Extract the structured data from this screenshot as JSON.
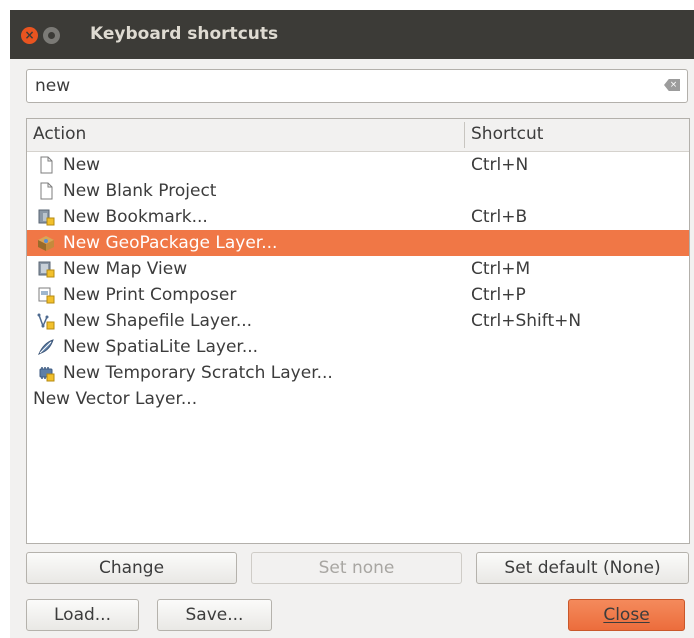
{
  "window": {
    "title": "Keyboard shortcuts",
    "close_glyph": "×"
  },
  "search": {
    "value": "new",
    "clear_glyph": "×"
  },
  "table": {
    "columns": [
      "Action",
      "Shortcut"
    ],
    "rows": [
      {
        "icon": "new-file-icon",
        "label": "New",
        "shortcut": "Ctrl+N",
        "selected": false
      },
      {
        "icon": "blank-project-icon",
        "label": "New Blank Project",
        "shortcut": "",
        "selected": false
      },
      {
        "icon": "bookmark-icon",
        "label": "New Bookmark...",
        "shortcut": "Ctrl+B",
        "selected": false
      },
      {
        "icon": "geopackage-icon",
        "label": "New GeoPackage Layer...",
        "shortcut": "",
        "selected": true
      },
      {
        "icon": "map-view-icon",
        "label": "New Map View",
        "shortcut": "Ctrl+M",
        "selected": false
      },
      {
        "icon": "print-composer-icon",
        "label": "New Print Composer",
        "shortcut": "Ctrl+P",
        "selected": false
      },
      {
        "icon": "shapefile-icon",
        "label": "New Shapefile Layer...",
        "shortcut": "Ctrl+Shift+N",
        "selected": false
      },
      {
        "icon": "spatialite-icon",
        "label": "New SpatiaLite Layer...",
        "shortcut": "",
        "selected": false
      },
      {
        "icon": "scratch-layer-icon",
        "label": "New Temporary Scratch Layer...",
        "shortcut": "",
        "selected": false
      },
      {
        "icon": "",
        "label": "New Vector Layer...",
        "shortcut": "",
        "selected": false
      }
    ]
  },
  "buttons": {
    "change": "Change",
    "set_none": "Set none",
    "set_default": "Set default (None)",
    "load": "Load...",
    "save": "Save...",
    "close": "Close"
  },
  "colors": {
    "selection": "#f07746",
    "titlebar": "#3c3b37",
    "close_button": "#e95420"
  }
}
